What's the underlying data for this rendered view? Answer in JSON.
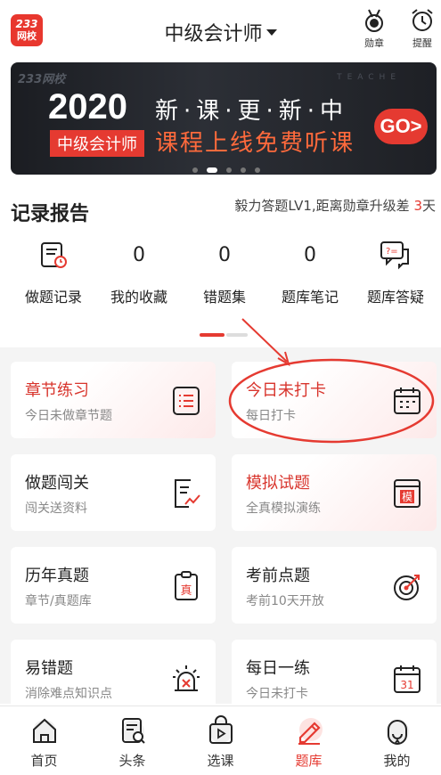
{
  "app": {
    "logo_top": "233",
    "logo_bottom": "网校",
    "title": "中级会计师"
  },
  "header_actions": [
    {
      "label": "勋章",
      "icon": "medal-icon"
    },
    {
      "label": "提醒",
      "icon": "alarm-clock-icon"
    }
  ],
  "banner": {
    "brand": "233网校",
    "watermark": "TEACHE",
    "year": "2020",
    "badge": "中级会计师",
    "line1": "新·课·更·新·中",
    "line2": "课程上线免费听课",
    "go": "GO>",
    "slides": 5,
    "active_slide": 2
  },
  "record": {
    "title": "记录报告",
    "note_prefix": "毅力答题LV1,距离勋章升级差",
    "note_count": "3",
    "note_suffix": "天",
    "stats": [
      {
        "label": "做题记录",
        "value": null,
        "icon": "calendar-record-icon"
      },
      {
        "label": "我的收藏",
        "value": "0",
        "icon": null
      },
      {
        "label": "错题集",
        "value": "0",
        "icon": null
      },
      {
        "label": "题库笔记",
        "value": "0",
        "icon": null
      },
      {
        "label": "题库答疑",
        "value": null,
        "icon": "chat-question-icon"
      }
    ]
  },
  "cards": [
    {
      "title": "章节练习",
      "subtitle": "今日未做章节题",
      "icon": "document-list-icon",
      "highlight": true
    },
    {
      "title": "今日未打卡",
      "subtitle": "每日打卡",
      "icon": "calendar-checkin-icon",
      "highlight": true
    },
    {
      "title": "做题闯关",
      "subtitle": "闯关送资料",
      "icon": "progress-document-icon",
      "highlight": false
    },
    {
      "title": "模拟试题",
      "subtitle": "全真模拟演练",
      "icon": "mock-exam-icon",
      "icon_text": "模",
      "highlight": true
    },
    {
      "title": "历年真题",
      "subtitle": "章节/真题库",
      "icon": "clipboard-real-icon",
      "icon_text": "真",
      "highlight": false
    },
    {
      "title": "考前点题",
      "subtitle": "考前10天开放",
      "icon": "target-icon",
      "highlight": false
    },
    {
      "title": "易错题",
      "subtitle": "消除难点知识点",
      "icon": "alarm-light-icon",
      "highlight": false
    },
    {
      "title": "每日一练",
      "subtitle": "今日未打卡",
      "icon": "calendar-daily-icon",
      "icon_text": "31",
      "highlight": false
    }
  ],
  "tabs": [
    {
      "label": "首页",
      "icon": "home-icon",
      "active": false
    },
    {
      "label": "头条",
      "icon": "news-icon",
      "active": false
    },
    {
      "label": "选课",
      "icon": "course-bag-icon",
      "active": false
    },
    {
      "label": "题库",
      "icon": "pencil-icon",
      "active": true
    },
    {
      "label": "我的",
      "icon": "profile-icon",
      "active": false
    }
  ],
  "colors": {
    "accent": "#e53a31",
    "text": "#222222",
    "muted": "#888888",
    "grid_bg": "#f4f4f4"
  }
}
